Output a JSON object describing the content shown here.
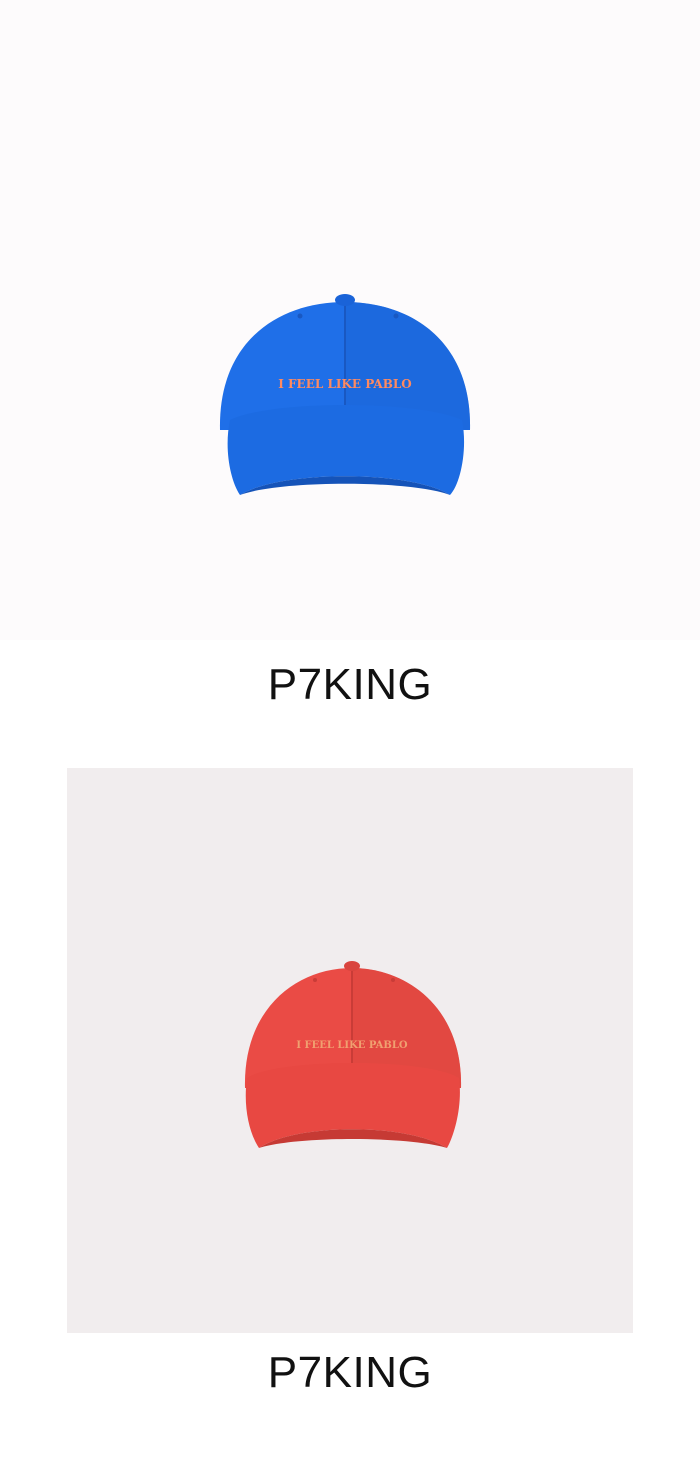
{
  "products": [
    {
      "brand": "P7KING",
      "image_label": "I FEEL LIKE PABLO",
      "color": "#1f6fe8",
      "accent": "#ff8a60",
      "panel_color": "#fdfbfc"
    },
    {
      "brand": "P7KING",
      "image_label": "I FEEL LIKE PABLO",
      "color": "#ea4b45",
      "accent": "#f0a070",
      "panel_color": "#f1edee"
    }
  ]
}
